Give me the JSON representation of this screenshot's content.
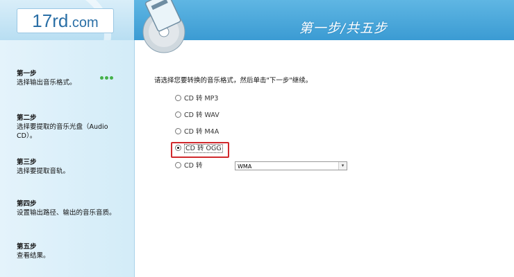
{
  "app": {
    "logo_main": "17rd",
    "logo_suffix": ".com",
    "step_header": "第一步/共五步"
  },
  "sidebar": {
    "steps": [
      {
        "title": "第一步",
        "desc": "选择输出音乐格式。"
      },
      {
        "title": "第二步",
        "desc": "选择要提取的音乐光盘（Audio CD）。"
      },
      {
        "title": "第三步",
        "desc": "选择要提取音轨。"
      },
      {
        "title": "第四步",
        "desc": "设置输出路径、输出的音乐音质。"
      },
      {
        "title": "第五步",
        "desc": "查看结果。"
      }
    ]
  },
  "main": {
    "instruction": "请选择您要转换的音乐格式，然后单击\"下一步\"继续。",
    "options": [
      {
        "label": "CD 转 MP3",
        "checked": false
      },
      {
        "label": "CD 转 WAV",
        "checked": false
      },
      {
        "label": "CD 转 M4A",
        "checked": false
      },
      {
        "label": "CD 转 OGG",
        "checked": true
      },
      {
        "label": "CD 转",
        "checked": false
      }
    ],
    "format_select": {
      "value": "WMA"
    }
  },
  "colors": {
    "header_blue": "#3b9bd3",
    "sidebar_bg": "#d3ecf8",
    "highlight_red": "#d0282c",
    "dot_green": "#45b14a"
  }
}
